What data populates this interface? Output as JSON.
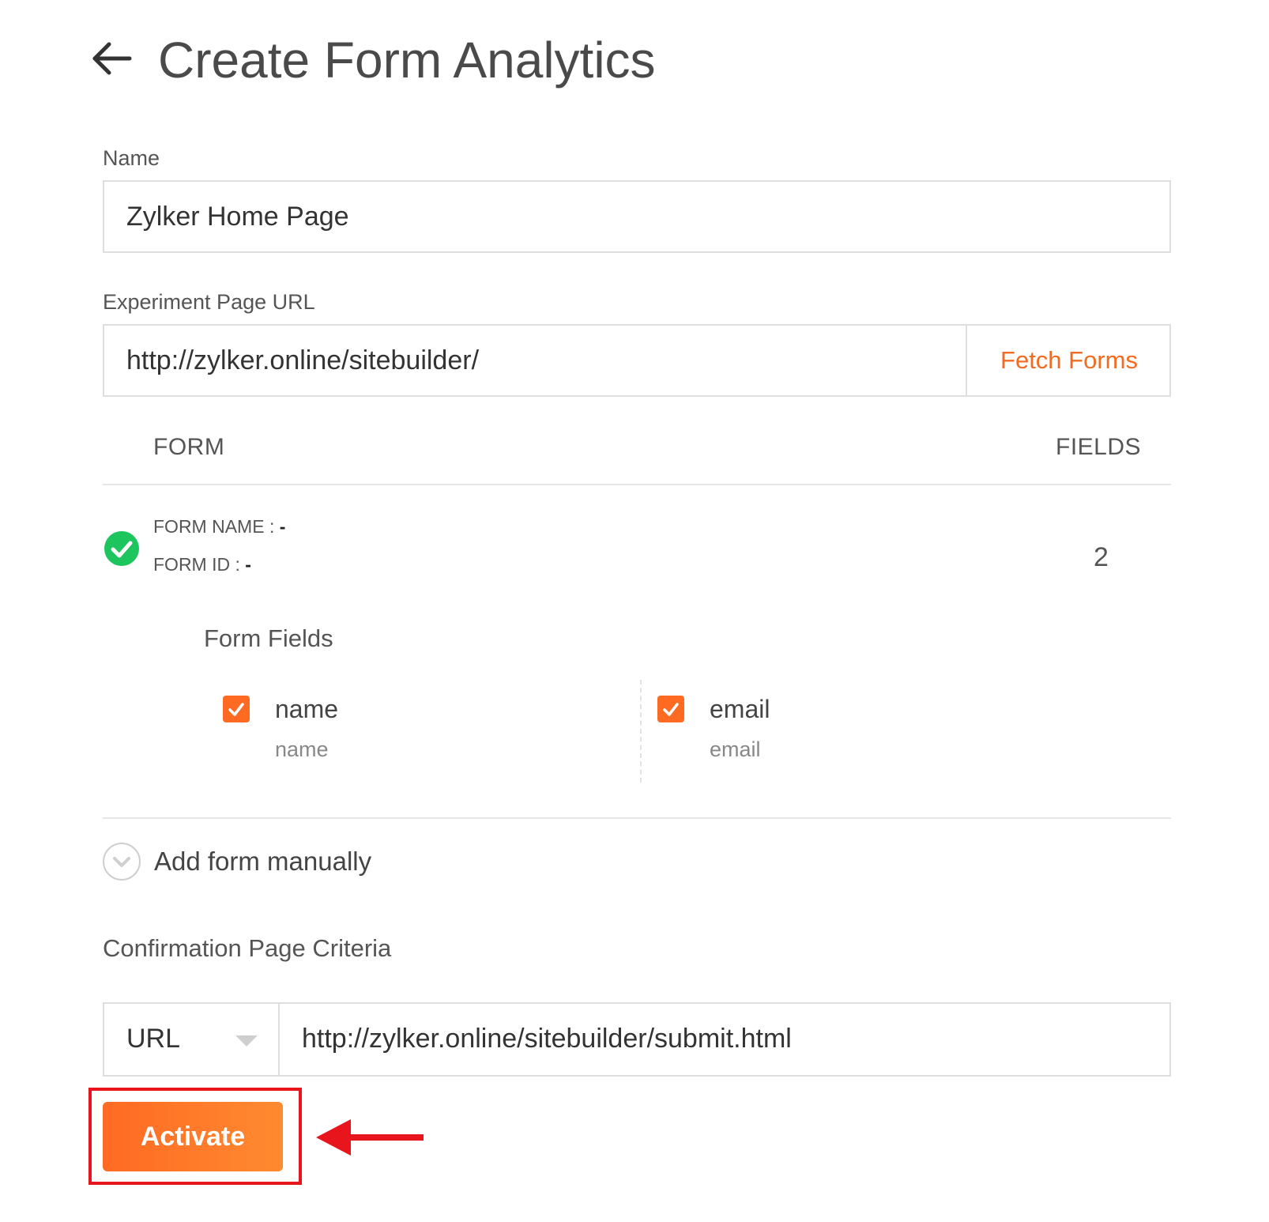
{
  "header": {
    "title": "Create Form Analytics",
    "back_icon": "arrow-left-icon"
  },
  "name_field": {
    "label": "Name",
    "value": "Zylker Home Page"
  },
  "url_field": {
    "label": "Experiment Page URL",
    "value": "http://zylker.online/sitebuilder/",
    "fetch_label": "Fetch Forms"
  },
  "table": {
    "col_form": "FORM",
    "col_fields": "FIELDS",
    "rows": [
      {
        "form_name_label": "FORM NAME : ",
        "form_name_value": "-",
        "form_id_label": "FORM ID : ",
        "form_id_value": "-",
        "fields_count": "2",
        "status_icon": "check-circle-icon"
      }
    ]
  },
  "form_fields": {
    "title": "Form Fields",
    "items": [
      {
        "label": "name",
        "sub": "name",
        "checked": true
      },
      {
        "label": "email",
        "sub": "email",
        "checked": true
      }
    ]
  },
  "add_manual": {
    "label": "Add form manually",
    "icon": "chevron-down-circle-icon"
  },
  "confirmation": {
    "title": "Confirmation Page Criteria",
    "type_selected": "URL",
    "url_value": "http://zylker.online/sitebuilder/submit.html"
  },
  "actions": {
    "activate_label": "Activate"
  },
  "colors": {
    "accent": "#ff6a23",
    "success": "#1dc55f",
    "annotation": "#e8151c"
  }
}
